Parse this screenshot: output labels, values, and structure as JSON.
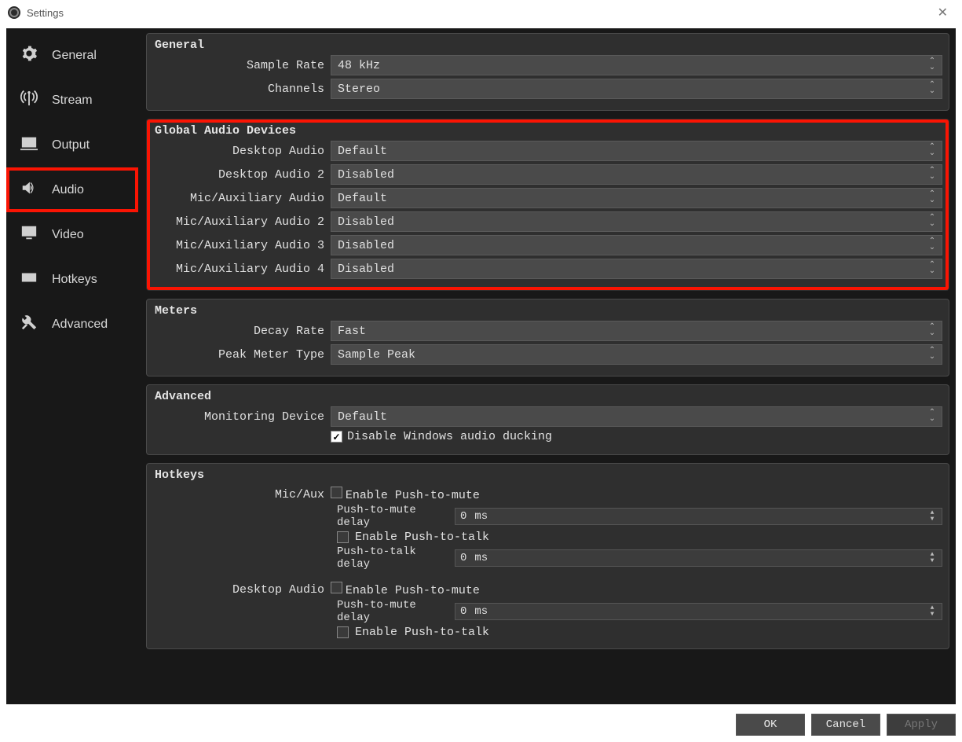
{
  "window": {
    "title": "Settings"
  },
  "sidebar": {
    "items": [
      {
        "label": "General"
      },
      {
        "label": "Stream"
      },
      {
        "label": "Output"
      },
      {
        "label": "Audio"
      },
      {
        "label": "Video"
      },
      {
        "label": "Hotkeys"
      },
      {
        "label": "Advanced"
      }
    ]
  },
  "general": {
    "title": "General",
    "sample_rate_label": "Sample Rate",
    "sample_rate_value": "48 kHz",
    "channels_label": "Channels",
    "channels_value": "Stereo"
  },
  "global_audio": {
    "title": "Global Audio Devices",
    "rows": [
      {
        "label": "Desktop Audio",
        "value": "Default"
      },
      {
        "label": "Desktop Audio 2",
        "value": "Disabled"
      },
      {
        "label": "Mic/Auxiliary Audio",
        "value": "Default"
      },
      {
        "label": "Mic/Auxiliary Audio 2",
        "value": "Disabled"
      },
      {
        "label": "Mic/Auxiliary Audio 3",
        "value": "Disabled"
      },
      {
        "label": "Mic/Auxiliary Audio 4",
        "value": "Disabled"
      }
    ]
  },
  "meters": {
    "title": "Meters",
    "decay_label": "Decay Rate",
    "decay_value": "Fast",
    "peak_label": "Peak Meter Type",
    "peak_value": "Sample Peak"
  },
  "advanced": {
    "title": "Advanced",
    "monitoring_label": "Monitoring Device",
    "monitoring_value": "Default",
    "ducking_label": "Disable Windows audio ducking"
  },
  "hotkeys": {
    "title": "Hotkeys",
    "micaux_label": "Mic/Aux",
    "desktop_label": "Desktop Audio",
    "ptm_enable": "Enable Push-to-mute",
    "ptm_delay_label": "Push-to-mute delay",
    "ptm_value": "0",
    "ptm_unit": "ms",
    "ptt_enable": "Enable Push-to-talk",
    "ptt_delay_label": "Push-to-talk delay",
    "ptt_value": "0",
    "ptt_unit": "ms"
  },
  "buttons": {
    "ok": "OK",
    "cancel": "Cancel",
    "apply": "Apply"
  }
}
